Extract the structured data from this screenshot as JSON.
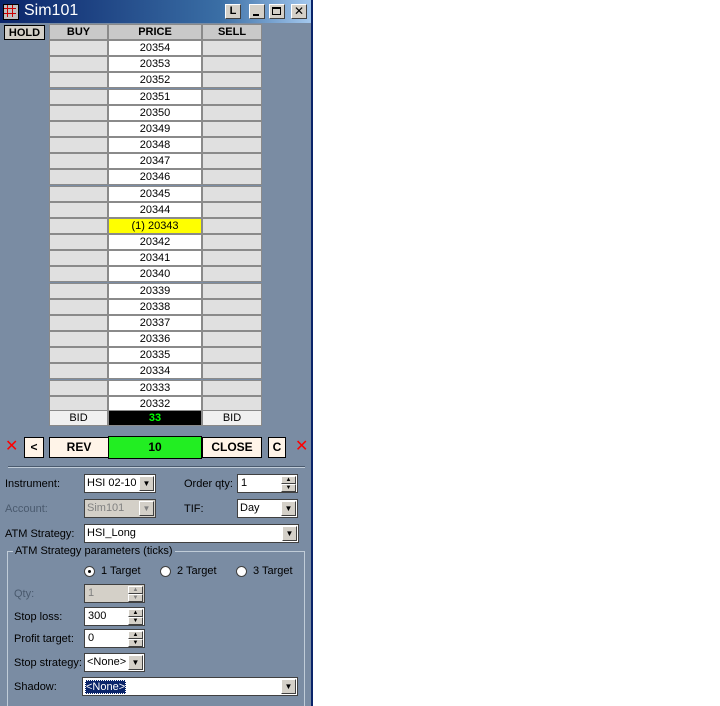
{
  "window": {
    "title": "Sim101",
    "buttons": {
      "l": "L"
    }
  },
  "hold_label": "HOLD",
  "ladder": {
    "headers": {
      "buy": "BUY",
      "price": "PRICE",
      "sell": "SELL"
    },
    "prices": [
      "20354",
      "20353",
      "20352",
      "20351",
      "20350",
      "20349",
      "20348",
      "20347",
      "20346",
      "20345",
      "20344",
      "(1) 20343",
      "20342",
      "20341",
      "20340",
      "20339",
      "20338",
      "20337",
      "20336",
      "20335",
      "20334",
      "20333",
      "20332"
    ],
    "current_index": 11,
    "footer": {
      "buy": "BID",
      "price": "33",
      "sell": "BID"
    }
  },
  "actions": {
    "left_arrow": "<",
    "rev": "REV",
    "qty": "10",
    "close": "CLOSE",
    "c": "C"
  },
  "form": {
    "instrument_label": "Instrument:",
    "instrument": "HSI 02-10",
    "order_qty_label": "Order qty:",
    "order_qty": "1",
    "account_label": "Account:",
    "account": "Sim101",
    "tif_label": "TIF:",
    "tif": "Day",
    "atm_label": "ATM Strategy:",
    "atm": "HSI_Long"
  },
  "atm_params": {
    "title": "ATM Strategy parameters (ticks)",
    "targets": [
      "1 Target",
      "2 Target",
      "3 Target"
    ],
    "selected_target": 0,
    "qty_label": "Qty:",
    "qty": "1",
    "stop_loss_label": "Stop loss:",
    "stop_loss": "300",
    "profit_target_label": "Profit target:",
    "profit_target": "0",
    "stop_strategy_label": "Stop strategy:",
    "stop_strategy": "<None>",
    "shadow_label": "Shadow:",
    "shadow": "<None>"
  },
  "colors": {
    "window_bg": "#7a8ca3",
    "current_price": "#ffff00",
    "qty_bar": "#22ee22",
    "last_qty_text": "#00ff00"
  }
}
